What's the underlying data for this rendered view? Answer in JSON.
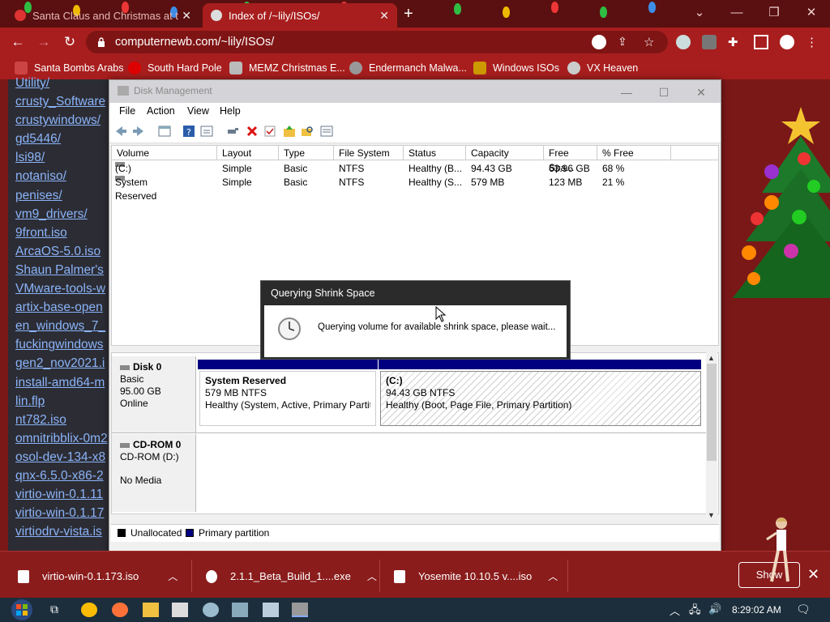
{
  "browser": {
    "tabs": [
      {
        "title": "Santa Claus and Christmas at th",
        "active": false
      },
      {
        "title": "Index of /~lily/ISOs/",
        "active": true
      }
    ],
    "url": "computernewb.com/~lily/ISOs/",
    "bookmarks": [
      "Santa Bombs Arabs",
      "South Hard Pole",
      "MEMZ Christmas E...",
      "Endermanch Malwa...",
      "Windows ISOs",
      "VX Heaven"
    ]
  },
  "page": {
    "links": [
      "Utility/",
      "crusty_Software",
      "crustywindows/",
      "gd5446/",
      "lsi98/",
      "notaniso/",
      "penises/",
      "vm9_drivers/",
      "9front.iso",
      "ArcaOS-5.0.iso",
      "Shaun Palmer's",
      "VMware-tools-w",
      "artix-base-open",
      "en_windows_7_",
      "fuckingwindows",
      "gen2_nov2021.i",
      "install-amd64-m",
      "lin.flp",
      "nt782.iso",
      "omnitribblix-0m2",
      "osol-dev-134-x8",
      "qnx-6.5.0-x86-2",
      "virtio-win-0.1.11",
      "virtio-win-0.1.17",
      "virtiodrv-vista.is"
    ]
  },
  "dm": {
    "title": "Disk Management",
    "menu": [
      "File",
      "Action",
      "View",
      "Help"
    ],
    "columns": [
      "Volume",
      "Layout",
      "Type",
      "File System",
      "Status",
      "Capacity",
      "Free Spa...",
      "% Free"
    ],
    "rows": [
      [
        "(C:)",
        "Simple",
        "Basic",
        "NTFS",
        "Healthy (B...",
        "94.43 GB",
        "63.96 GB",
        "68 %"
      ],
      [
        "System Reserved",
        "Simple",
        "Basic",
        "NTFS",
        "Healthy (S...",
        "579 MB",
        "123 MB",
        "21 %"
      ]
    ],
    "disk0": {
      "name": "Disk 0",
      "type": "Basic",
      "size": "95.00 GB",
      "state": "Online"
    },
    "part1": {
      "name": "System Reserved",
      "size": "579 MB NTFS",
      "status": "Healthy (System, Active, Primary Partiti"
    },
    "part2": {
      "name": "(C:)",
      "size": "94.43 GB NTFS",
      "status": "Healthy (Boot, Page File, Primary Partition)"
    },
    "cdrom": {
      "name": "CD-ROM 0",
      "drive": "CD-ROM (D:)",
      "media": "No Media"
    },
    "legend": [
      "Unallocated",
      "Primary partition"
    ]
  },
  "dialog": {
    "title": "Querying Shrink Space",
    "message": "Querying volume for available shrink space, please wait..."
  },
  "downloads": {
    "items": [
      "virtio-win-0.1.173.iso",
      "2.1.1_Beta_Build_1....exe",
      "Yosemite 10.10.5 v....iso"
    ],
    "show_all": "Show"
  },
  "taskbar": {
    "time": "8:29:02 AM"
  },
  "colors": {
    "primary_partition": "#000080",
    "unallocated": "#000000",
    "browser_red": "#a81e1e"
  }
}
